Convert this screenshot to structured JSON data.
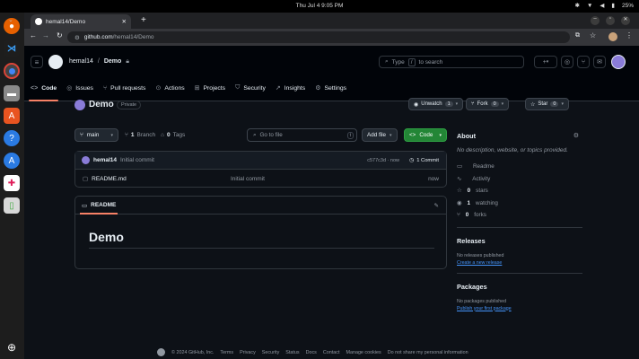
{
  "system": {
    "clock": "Thu Jul 4   9:05 PM",
    "battery": "25%"
  },
  "browser": {
    "tab_title": "hemal14/Demo",
    "url_host": "github.com",
    "url_path": "/hemal14/Demo"
  },
  "header": {
    "owner": "hemal14",
    "separator": "/",
    "repo": "Demo",
    "search_prefix": "Type",
    "search_key": "/",
    "search_suffix": "to search"
  },
  "repo_tabs": [
    {
      "label": "Code",
      "icon": "code-icon"
    },
    {
      "label": "Issues",
      "icon": "issue-icon"
    },
    {
      "label": "Pull requests",
      "icon": "pull-request-icon"
    },
    {
      "label": "Actions",
      "icon": "play-icon"
    },
    {
      "label": "Projects",
      "icon": "table-icon"
    },
    {
      "label": "Security",
      "icon": "shield-icon"
    },
    {
      "label": "Insights",
      "icon": "graph-icon"
    },
    {
      "label": "Settings",
      "icon": "gear-icon"
    }
  ],
  "repo": {
    "name": "Demo",
    "visibility": "Private",
    "unwatch_label": "Unwatch",
    "unwatch_count": "1",
    "fork_label": "Fork",
    "fork_count": "0",
    "star_label": "Star",
    "star_count": "0"
  },
  "toolbar": {
    "branch": "main",
    "branch_count": "1",
    "branch_label": "Branch",
    "tag_count": "0",
    "tag_label": "Tags",
    "go_to_file": "Go to file",
    "go_to_file_key": "t",
    "add_file": "Add file",
    "code": "Code"
  },
  "commit": {
    "author": "hemal14",
    "message": "Initial commit",
    "hash_time": "c577c3d · now",
    "count": "1 Commit"
  },
  "files": [
    {
      "name": "README.md",
      "message": "Initial commit",
      "time": "now"
    }
  ],
  "readme": {
    "tab": "README",
    "heading": "Demo"
  },
  "about": {
    "title": "About",
    "description": "No description, website, or topics provided.",
    "items": [
      {
        "count": "",
        "label": "Readme",
        "icon": "book-icon"
      },
      {
        "count": "",
        "label": "Activity",
        "icon": "pulse-icon"
      },
      {
        "count": "0",
        "label": "stars",
        "icon": "star-icon"
      },
      {
        "count": "1",
        "label": "watching",
        "icon": "eye-icon"
      },
      {
        "count": "0",
        "label": "forks",
        "icon": "fork-icon"
      }
    ]
  },
  "releases": {
    "title": "Releases",
    "empty": "No releases published",
    "link": "Create a new release"
  },
  "packages": {
    "title": "Packages",
    "empty": "No packages published",
    "link": "Publish your first package"
  },
  "footer": {
    "copyright": "© 2024 GitHub, Inc.",
    "links": [
      "Terms",
      "Privacy",
      "Security",
      "Status",
      "Docs",
      "Contact",
      "Manage cookies",
      "Do not share my personal information"
    ]
  }
}
